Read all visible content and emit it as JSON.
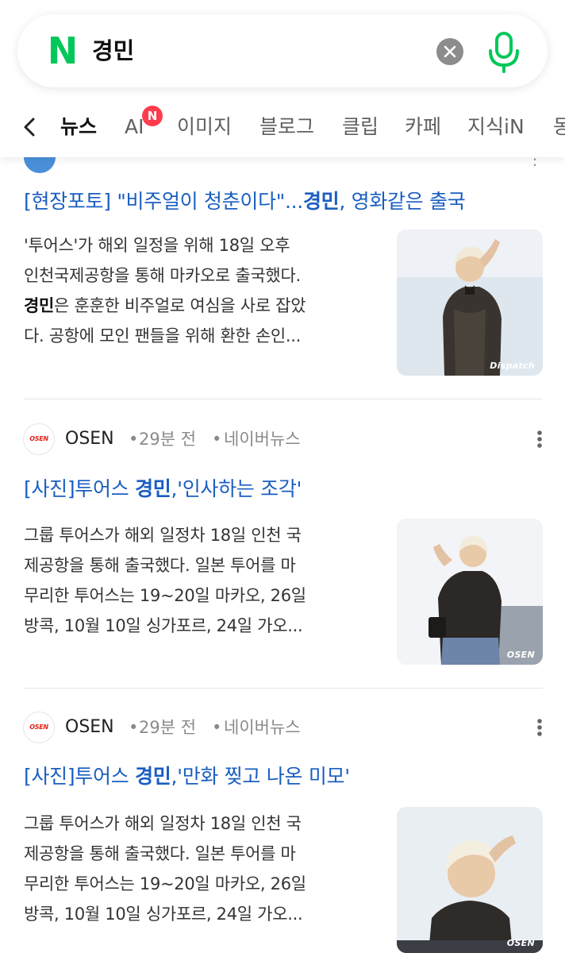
{
  "search": {
    "brand_letter": "N",
    "query": "경민"
  },
  "tabs": [
    {
      "label": "뉴스",
      "active": true
    },
    {
      "label": "AI",
      "badge": "N"
    },
    {
      "label": "이미지"
    },
    {
      "label": "블로그"
    },
    {
      "label": "클립"
    },
    {
      "label": "카페"
    },
    {
      "label": "지식iN"
    },
    {
      "label": "동"
    }
  ],
  "articles": [
    {
      "title_pre": "[현장포토] \"비주얼이 청춘이다\"...",
      "title_bold": "경민",
      "title_post": ", 영화같은 출국",
      "desc_lines": [
        {
          "text": "'투어스'가 해외 일정을 위해 18일 오후"
        },
        {
          "text": "인천국제공항을 통해 마카오로 출국했다."
        },
        {
          "bold": "경민",
          "text": "은 훈훈한 비주얼로 여심을 사로 잡았"
        },
        {
          "text": "다. 공항에 모인 팬들을 위해 환한 손인..."
        }
      ],
      "thumb_watermark": "Dispatch"
    },
    {
      "source_logo": "OSEN",
      "source": "OSEN",
      "time": "29분 전",
      "platform": "네이버뉴스",
      "sep": "•",
      "title_pre": "[사진]투어스 ",
      "title_bold": "경민",
      "title_post": ",'인사하는 조각'",
      "desc_lines": [
        {
          "text": "그룹 투어스가 해외 일정차 18일 인천 국"
        },
        {
          "text": "제공항을 통해 출국했다. 일본 투어를 마"
        },
        {
          "text": "무리한 투어스는 19~20일 마카오, 26일"
        },
        {
          "text": "방콕, 10월 10일 싱가포르, 24일 가오..."
        }
      ],
      "thumb_watermark": "OSEN"
    },
    {
      "source_logo": "OSEN",
      "source": "OSEN",
      "time": "29분 전",
      "platform": "네이버뉴스",
      "sep": "•",
      "title_pre": "[사진]투어스 ",
      "title_bold": "경민",
      "title_post": ",'만화 찢고 나온 미모'",
      "desc_lines": [
        {
          "text": "그룹 투어스가 해외 일정차 18일 인천 국"
        },
        {
          "text": "제공항을 통해 출국했다. 일본 투어를 마"
        },
        {
          "text": "무리한 투어스는 19~20일 마카오, 26일"
        },
        {
          "text": "방콕, 10월 10일 싱가포르, 24일 가오..."
        }
      ],
      "thumb_watermark": "OSEN"
    }
  ],
  "colors": {
    "naver_green": "#03c75a",
    "link_blue": "#1a5ec1",
    "badge_red": "#ff3b4d"
  },
  "icons": [
    "naver-logo-icon",
    "clear-icon",
    "mic-icon",
    "chevron-left-icon",
    "more-vertical-icon"
  ]
}
